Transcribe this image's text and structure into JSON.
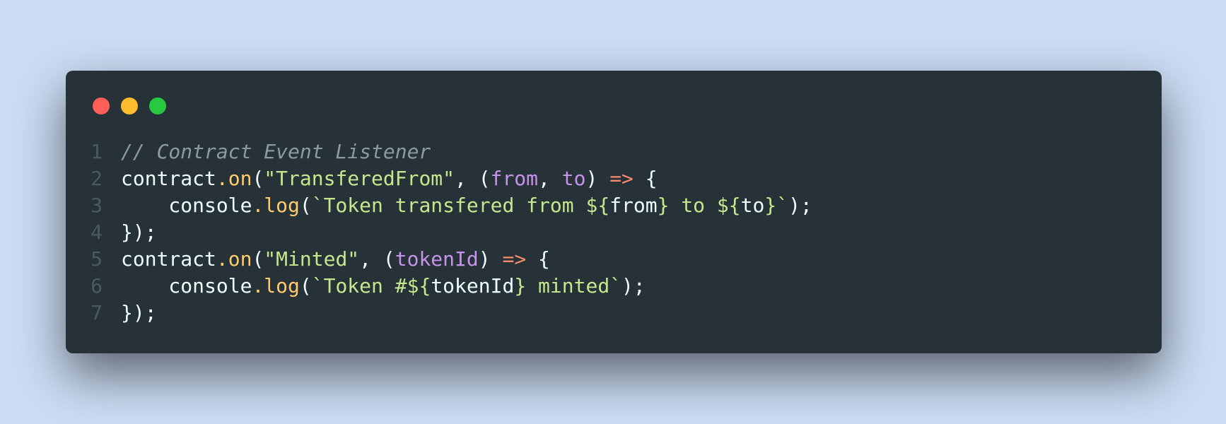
{
  "window": {
    "controls": {
      "close_color": "#ff5f56",
      "minimize_color": "#ffbd2e",
      "maximize_color": "#27c93f"
    }
  },
  "code": {
    "lines": [
      {
        "number": "1",
        "tokens": [
          {
            "t": "// Contract Event Listener",
            "c": "cmt"
          }
        ]
      },
      {
        "number": "2",
        "tokens": [
          {
            "t": "contract",
            "c": "var"
          },
          {
            "t": ".",
            "c": "dotp"
          },
          {
            "t": "on",
            "c": "fn"
          },
          {
            "t": "(",
            "c": "punc"
          },
          {
            "t": "\"TransferedFrom\"",
            "c": "str"
          },
          {
            "t": ", (",
            "c": "punc"
          },
          {
            "t": "from",
            "c": "param"
          },
          {
            "t": ", ",
            "c": "punc"
          },
          {
            "t": "to",
            "c": "param"
          },
          {
            "t": ") ",
            "c": "punc"
          },
          {
            "t": "=>",
            "c": "arrow"
          },
          {
            "t": " {",
            "c": "punc"
          }
        ]
      },
      {
        "number": "3",
        "tokens": [
          {
            "t": "    console",
            "c": "var"
          },
          {
            "t": ".",
            "c": "dotp"
          },
          {
            "t": "log",
            "c": "fn"
          },
          {
            "t": "(",
            "c": "punc"
          },
          {
            "t": "`Token transfered from ${",
            "c": "str"
          },
          {
            "t": "from",
            "c": "var"
          },
          {
            "t": "} to ${",
            "c": "str"
          },
          {
            "t": "to",
            "c": "var"
          },
          {
            "t": "}`",
            "c": "str"
          },
          {
            "t": ");",
            "c": "punc"
          }
        ]
      },
      {
        "number": "4",
        "tokens": [
          {
            "t": "});",
            "c": "punc"
          }
        ]
      },
      {
        "number": "5",
        "tokens": [
          {
            "t": "contract",
            "c": "var"
          },
          {
            "t": ".",
            "c": "dotp"
          },
          {
            "t": "on",
            "c": "fn"
          },
          {
            "t": "(",
            "c": "punc"
          },
          {
            "t": "\"Minted\"",
            "c": "str"
          },
          {
            "t": ", (",
            "c": "punc"
          },
          {
            "t": "tokenId",
            "c": "param"
          },
          {
            "t": ") ",
            "c": "punc"
          },
          {
            "t": "=>",
            "c": "arrow"
          },
          {
            "t": " {",
            "c": "punc"
          }
        ]
      },
      {
        "number": "6",
        "tokens": [
          {
            "t": "    console",
            "c": "var"
          },
          {
            "t": ".",
            "c": "dotp"
          },
          {
            "t": "log",
            "c": "fn"
          },
          {
            "t": "(",
            "c": "punc"
          },
          {
            "t": "`Token #${",
            "c": "str"
          },
          {
            "t": "tokenId",
            "c": "var"
          },
          {
            "t": "} minted`",
            "c": "str"
          },
          {
            "t": ");",
            "c": "punc"
          }
        ]
      },
      {
        "number": "7",
        "tokens": [
          {
            "t": "});",
            "c": "punc"
          }
        ]
      }
    ]
  }
}
